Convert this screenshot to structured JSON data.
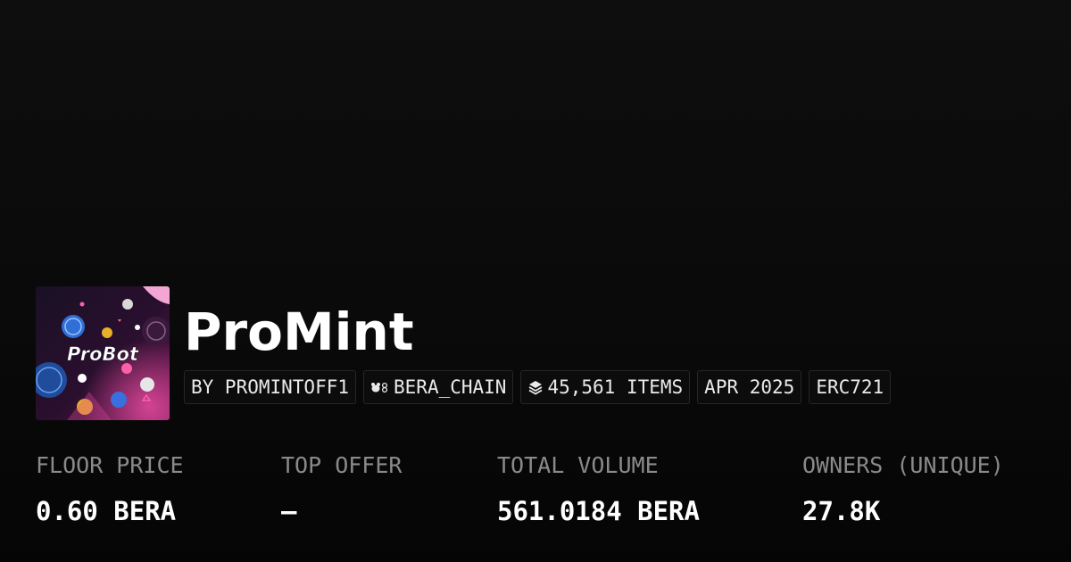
{
  "collection": {
    "image_alt": "ProBot",
    "logo_text": "ProBot",
    "title": "ProMint"
  },
  "chips": {
    "creator": "BY PROMINTOFF1",
    "chain": "BERA_CHAIN",
    "chain_icon": "bear-chain-icon",
    "items": "45,561 ITEMS",
    "items_icon": "layers-icon",
    "date": "APR 2025",
    "standard": "ERC721"
  },
  "stats": [
    {
      "label": "FLOOR PRICE",
      "value": "0.60 BERA"
    },
    {
      "label": "TOP OFFER",
      "value": "—"
    },
    {
      "label": "TOTAL VOLUME",
      "value": "561.0184 BERA"
    },
    {
      "label": "OWNERS (UNIQUE)",
      "value": "27.8K"
    }
  ],
  "colors": {
    "background": "#0a0a0a",
    "chip_border": "#262626",
    "label": "#8a8a8a",
    "value": "#ffffff",
    "image_accent": "#e0489a"
  }
}
